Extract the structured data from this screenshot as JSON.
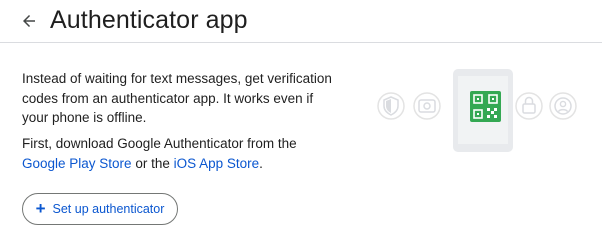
{
  "header": {
    "back_icon": "arrow-back-icon",
    "title": "Authenticator app"
  },
  "main": {
    "description": "Instead of waiting for text messages, get verification codes from an authenticator app. It works even if your phone is offline.",
    "download": {
      "prefix": "First, download Google Authenticator from the ",
      "google_play_link": "Google Play Store",
      "middle": " or the ",
      "app_store_link": "iOS App Store",
      "suffix": "."
    },
    "setup_button": {
      "icon": "plus-icon",
      "label": "Set up authenticator"
    }
  },
  "illustration": {
    "icons": [
      "shield-icon",
      "camera-icon",
      "qr-code-icon",
      "lock-icon",
      "person-icon"
    ],
    "accent": "#34a853"
  }
}
